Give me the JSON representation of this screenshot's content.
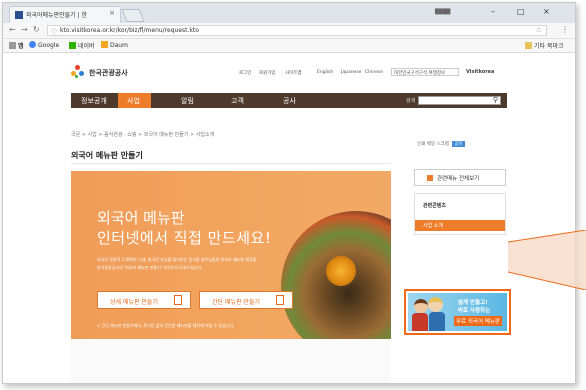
{
  "browser": {
    "tab_title": "외국어메뉴판만들기 | 한",
    "tab_close": "×",
    "window_user": "████",
    "min": "–",
    "max": "□",
    "close": "×",
    "url": "kto.visitkorea.or.kr/kor/biz/fl/menu/request.kto",
    "bookmarks": {
      "apps": "앱",
      "google": "Google",
      "naver": "네이버",
      "daum": "Daum",
      "other": "기타 북마크"
    }
  },
  "site": {
    "logo_text": "한국관광공사",
    "util_links": [
      "로그인",
      "회원가입",
      "사이트맵",
      "English",
      "Japanese",
      "Chinese"
    ],
    "related_select": "대한민국구석구석 여행정보",
    "brand": "Visitkorea",
    "gnb": [
      "정보공개",
      "사업",
      "알림",
      "고객",
      "공사"
    ],
    "search_label": "검색",
    "breadcrumb": "국문 > 사업 > 음식관광 · 쇼핑 > 외국어 메뉴판 만들기 > 사업소개",
    "page_title": "외국어 메뉴판 만들기",
    "tools": "인쇄  메일  스크랩",
    "tools_badge": "공유",
    "hero": {
      "title1": "외국어 메뉴판",
      "title2": "인터넷에서 직접 만드세요!",
      "desc1": "외국인 관광객 1,000만 시대, 외국인 손님을 맞이하는 음식점 점주님들의 외국어 메뉴판 제작을",
      "desc2": "한국관광공사의 '외국어 메뉴판 만들기' 사이트가 도와드립니다.",
      "btn_detail": "상세 메뉴판 만들기",
      "btn_simple": "간단 메뉴판 만들기",
      "note": "✔ 간단 메뉴판 만들기에서, 로그인 없이 간단한 메뉴판을 제작해 보실 수 있습니다."
    },
    "sidebar": {
      "all_menu": "관련메뉴 전체보기",
      "related_header": "관련콘텐츠",
      "related_item": "사업 소개"
    },
    "promo": {
      "line1": "쉽게 만들고!",
      "line2": "바로 사용하는",
      "line3": "무료 외국어 메뉴판"
    }
  },
  "colors": {
    "accent": "#ee7d2b",
    "gnb": "#4d3a2c",
    "callout": "#ee6a1a"
  }
}
